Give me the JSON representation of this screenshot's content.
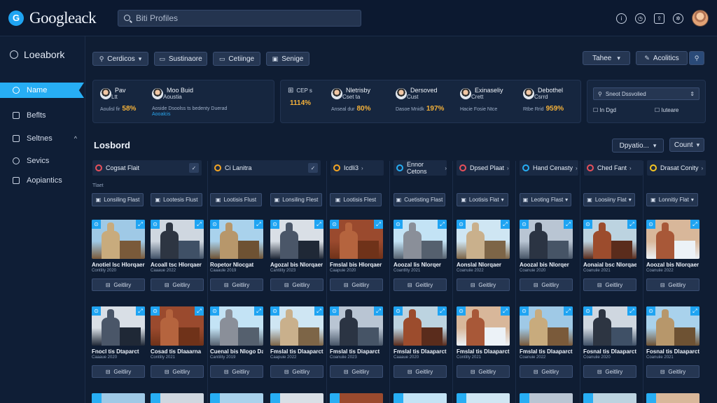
{
  "app": {
    "logo_letter": "G",
    "logo_text": "Googleack"
  },
  "search": {
    "placeholder": "Biti Profiles"
  },
  "top_icons": [
    "info-icon",
    "clock-icon",
    "share-icon",
    "settings-icon"
  ],
  "sidebar": {
    "title": "Loeabork",
    "items": [
      {
        "label": "Name",
        "active": true,
        "icon": "home-icon"
      },
      {
        "label": "Beflts",
        "active": false,
        "icon": "list-icon"
      },
      {
        "label": "Seltnes",
        "active": false,
        "icon": "grid-icon",
        "chevron": "^"
      },
      {
        "label": "Sevics",
        "active": false,
        "icon": "circle-icon"
      },
      {
        "label": "Aopiantics",
        "active": false,
        "icon": "tag-icon"
      }
    ]
  },
  "toolbar": {
    "filter1": "Cerdicos",
    "filter2": "Sustinaore",
    "filter3": "Cetiinge",
    "filter4": "Senige",
    "right1": "Tahee",
    "right2": "Acolitics"
  },
  "stats_left": [
    {
      "name": "Pav",
      "sub": "Ltt",
      "foot": "Aoulisl fir",
      "value": "58%"
    },
    {
      "name": "Moo Buid",
      "sub": "Aoustia",
      "foot": "Aoside Dsoolss ts bedenty Duerad",
      "link": "Aooalcis"
    }
  ],
  "stats_right": [
    {
      "name": "",
      "sub": "CEP s",
      "foot": "",
      "value": "1114%"
    },
    {
      "name": "Nletrisby",
      "sub": "Cset ta",
      "foot": "Anseal dur",
      "value": "80%"
    },
    {
      "name": "Dersoved",
      "sub": "Cust",
      "foot": "Dasoe Mnidk",
      "value": "197%"
    },
    {
      "name": "Exinaseliy",
      "sub": "Crett",
      "foot": "Hacie Fosie Ntce",
      "value": ""
    },
    {
      "name": "Debothel",
      "sub": "Csrrd",
      "foot": "Rtbe Rrid",
      "value": "959%"
    }
  ],
  "filter_panel": {
    "select": "Sneot Dssvolied",
    "opt1": "In Dgd",
    "opt2": "Iuteare"
  },
  "section": {
    "title": "Losbord",
    "sort": "Dpyatio...",
    "count": "Count"
  },
  "columns": [
    {
      "label": "Cogsat Flait",
      "color": "#e8505b"
    },
    {
      "label": "Ci Lanitra",
      "color": "#f5a623"
    },
    {
      "label": "Icdli3",
      "color": "#f5a623"
    },
    {
      "label": "Ennor Cetons",
      "color": "#27aef4"
    },
    {
      "label": "Dpsed Plaat",
      "color": "#e8505b"
    },
    {
      "label": "Hand Cenasty",
      "color": "#27aef4"
    },
    {
      "label": "Ched Fant",
      "color": "#e8505b"
    },
    {
      "label": "Drasat Conity",
      "color": "#f5c623"
    }
  ],
  "row_label": "Tlaet",
  "chips": [
    "Lonsiling Flast",
    "Lootesis Flust",
    "Lootisis Flust",
    "Lonsiling Flest",
    "Lootisis Flest",
    "Cuetisting Flast",
    "Lootisis Flat",
    "Leoting Flast",
    "Loosiiny Flat",
    "Lonnitiy Flat"
  ],
  "cards_row1": [
    {
      "title": "Anotiel lsc Hlorqaer",
      "sub": "Contlity 2020"
    },
    {
      "title": "Acoall tsc Hlorqaer",
      "sub": "Caaaue 2022"
    },
    {
      "title": "Ropetor Nlocgat",
      "sub": "Caaaule 2019"
    },
    {
      "title": "Agozal bis Nlorqaer",
      "sub": "Cantility 2023"
    },
    {
      "title": "Fmslal bis Hlorqaer",
      "sub": "Caapuie 2020"
    },
    {
      "title": "Aoozal lis Nlorqer",
      "sub": "Coantlity 2021"
    },
    {
      "title": "Aonslal Nlorqaer",
      "sub": "Coanuiie 2022"
    },
    {
      "title": "Aoozal bis Nlorqer",
      "sub": "Coanuie 2020"
    },
    {
      "title": "Aonaial bsc Nlorqaer",
      "sub": "Coanuiie 2021"
    },
    {
      "title": "Aoozal bis Nlorqaer",
      "sub": "Coanuiie 2022"
    }
  ],
  "cards_row2": [
    {
      "title": "Fnocl tis Dtaparct",
      "sub": "Caaaue 2020"
    },
    {
      "title": "Cosad tis Dlaaarna",
      "sub": "Contlity 2021"
    },
    {
      "title": "Cuenal bis Nlogo Daqu",
      "sub": "Cantility 2019"
    },
    {
      "title": "Fmslal tis Dlaaparct",
      "sub": "Caapuie 2022"
    },
    {
      "title": "Fmslal tis Diaparct",
      "sub": "Coanuiie 2023"
    },
    {
      "title": "Fmslal tis Dlaaparct",
      "sub": "Caaaue 2020"
    },
    {
      "title": "Fmslal tis Dlaaparct",
      "sub": "Contlity 2021"
    },
    {
      "title": "Fmslal tis Dlaaparct",
      "sub": "Coanuie 2022"
    },
    {
      "title": "Fosnal tis Dlaaparct",
      "sub": "Coanuiie 2020"
    },
    {
      "title": "Fosnal tis Dlaaparct",
      "sub": "Coanuiie 2021"
    }
  ],
  "gallery_label": "Geitliry"
}
